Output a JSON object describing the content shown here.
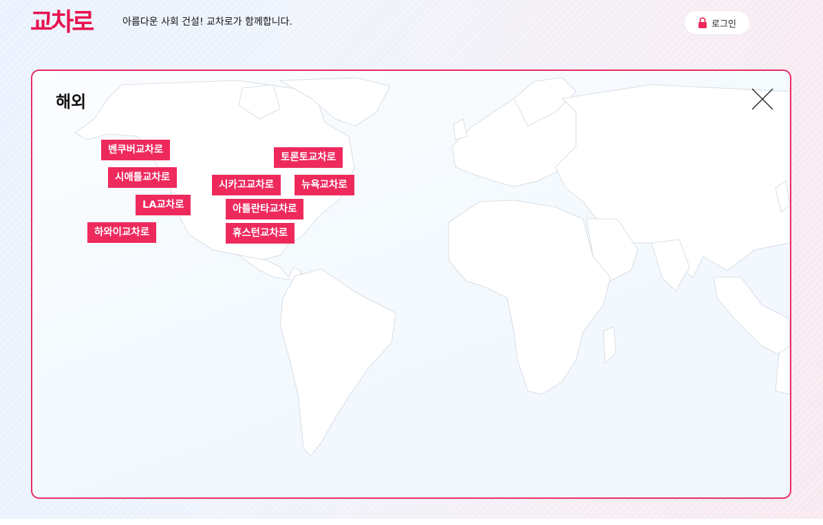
{
  "header": {
    "logo_text": "교차로",
    "tagline": "아름다운 사회 건설! 교차로가 함께합니다.",
    "login_label": "로그인",
    "login_icon": "lock-icon"
  },
  "panel": {
    "title": "해외",
    "close_icon": "close-icon",
    "locations": [
      {
        "id": "vancouver",
        "label": "벤쿠버교차로"
      },
      {
        "id": "seattle",
        "label": "시애틀교차로"
      },
      {
        "id": "la",
        "label": "LA교차로"
      },
      {
        "id": "hawaii",
        "label": "하와이교차로"
      },
      {
        "id": "toronto",
        "label": "토론토교차로"
      },
      {
        "id": "chicago",
        "label": "시카고교차로"
      },
      {
        "id": "newyork",
        "label": "뉴욕교차로"
      },
      {
        "id": "atlanta",
        "label": "아틀란타교차로"
      },
      {
        "id": "houston",
        "label": "휴스턴교차로"
      }
    ]
  },
  "colors": {
    "brand": "#e8124f",
    "tag_background": "#ee2a5d",
    "panel_border": "#ea2a61"
  }
}
